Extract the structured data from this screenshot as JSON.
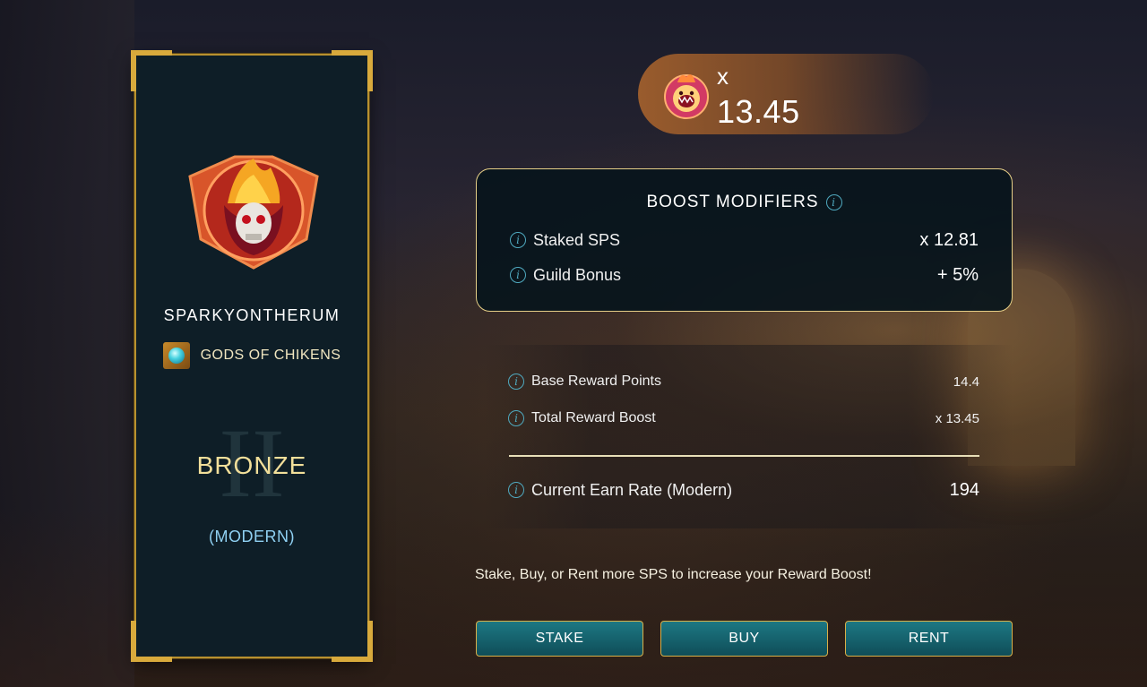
{
  "player": {
    "username": "SPARKYONTHERUM",
    "guild_name": "GODS OF CHIKENS",
    "tier_numeral": "II",
    "league": "BRONZE",
    "format": "(MODERN)"
  },
  "multiplier": {
    "prefix": "x",
    "value": "13.45"
  },
  "boost_modifiers": {
    "title": "BOOST MODIFIERS",
    "rows": [
      {
        "label": "Staked SPS",
        "value": "x 12.81"
      },
      {
        "label": "Guild Bonus",
        "value": "+ 5%"
      }
    ]
  },
  "rewards": {
    "base_reward_label": "Base Reward Points",
    "base_reward_value": "14.4",
    "total_boost_label": "Total Reward Boost",
    "total_boost_value": "x 13.45",
    "earn_rate_label": "Current Earn Rate (Modern)",
    "earn_rate_value": "194"
  },
  "cta_text": "Stake, Buy, or Rent more SPS to increase your Reward Boost!",
  "buttons": {
    "stake": "STAKE",
    "buy": "BUY",
    "rent": "RENT"
  },
  "colors": {
    "accent_gold": "#d8aa3c",
    "card_bg": "#0e1e27",
    "button_teal": "#1d7883",
    "info_blue": "#4fa9bf",
    "format_blue": "#8fd0f2",
    "league_gold": "#f2df9a"
  },
  "icons": {
    "avatar": "flaming-skull-badge",
    "guild": "guild-gem-icon",
    "multiplier": "fire-demon-icon",
    "info": "info-icon"
  }
}
